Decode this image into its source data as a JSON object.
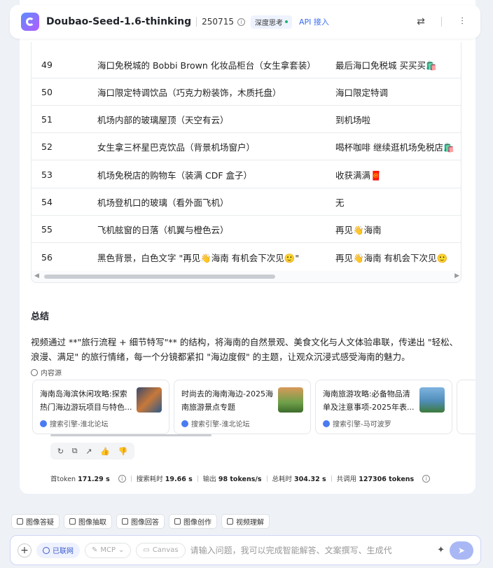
{
  "header": {
    "model_name": "Doubao-Seed-1.6-thinking",
    "version": "250715",
    "mode_tag": "深度思考",
    "api_link": "API 接入"
  },
  "table": {
    "rows": [
      {
        "no": "49",
        "scene": "海口免税城的 Bobbi Brown 化妆品柜台（女生拿套装）",
        "caption": "最后海口免税城 买买买🛍️"
      },
      {
        "no": "50",
        "scene": "海口限定特调饮品（巧克力粉装饰，木质托盘）",
        "caption": "海口限定特调"
      },
      {
        "no": "51",
        "scene": "机场内部的玻璃屋顶（天空有云）",
        "caption": "到机场啦"
      },
      {
        "no": "52",
        "scene": "女生拿三杯星巴克饮品（背景机场窗户）",
        "caption": "喝杯咖啡 继续逛机场免税店🛍️"
      },
      {
        "no": "53",
        "scene": "机场免税店的购物车（装满 CDF 盒子）",
        "caption": "收获满满🧧"
      },
      {
        "no": "54",
        "scene": "机场登机口的玻璃（看外面飞机）",
        "caption": "无"
      },
      {
        "no": "55",
        "scene": "飞机舷窗的日落（机翼与橙色云）",
        "caption": "再见👋海南"
      },
      {
        "no": "56",
        "scene": "黑色背景，白色文字 \"再见👋海南 有机会下次见🙂\"",
        "caption": "再见👋海南 有机会下次见🙂"
      }
    ]
  },
  "summary": {
    "title": "总结",
    "text": "视频通过 **\"旅行流程 + 细节特写\"** 的结构，将海南的自然景观、美食文化与人文体验串联，传递出 \"轻松、浪漫、满足\" 的旅行情绪，每一个分镜都紧扣 \"海边度假\" 的主题，让观众沉浸式感受海南的魅力。"
  },
  "sources": {
    "label": "内容源",
    "items": [
      {
        "title": "海南岛海滨休闲攻略:探索热门海边游玩项目与特色...",
        "meta": "搜索引擎-淮北论坛",
        "thumb_color": "#5a6a8a"
      },
      {
        "title": "时尚去的海南海边-2025海南旅游景点专题",
        "meta": "搜索引擎-淮北论坛",
        "thumb_color": "#6fa04a"
      },
      {
        "title": "海南旅游攻略:必备物品清单及注意事项-2025年表...",
        "meta": "搜索引擎-马可波罗",
        "thumb_color": "#4f8db8"
      }
    ]
  },
  "stats": {
    "first_token_label": "首token",
    "first_token": "171.29 s",
    "search_label": "搜索耗时",
    "search": "19.66 s",
    "output_label": "输出",
    "output": "98 tokens/s",
    "total_label": "总耗时",
    "total": "304.32 s",
    "used_label": "共调用",
    "used": "127306 tokens"
  },
  "tools": [
    "图像答疑",
    "图像抽取",
    "图像回答",
    "图像创作",
    "视频理解"
  ],
  "input": {
    "net_chip": "已联网",
    "mcp_chip": "MCP",
    "canvas_chip": "Canvas",
    "placeholder": "请输入问题，我可以完成智能解答、文案撰写、生成代"
  },
  "colors": {
    "accent": "#3a6df0",
    "send": "#a9b8f5"
  }
}
